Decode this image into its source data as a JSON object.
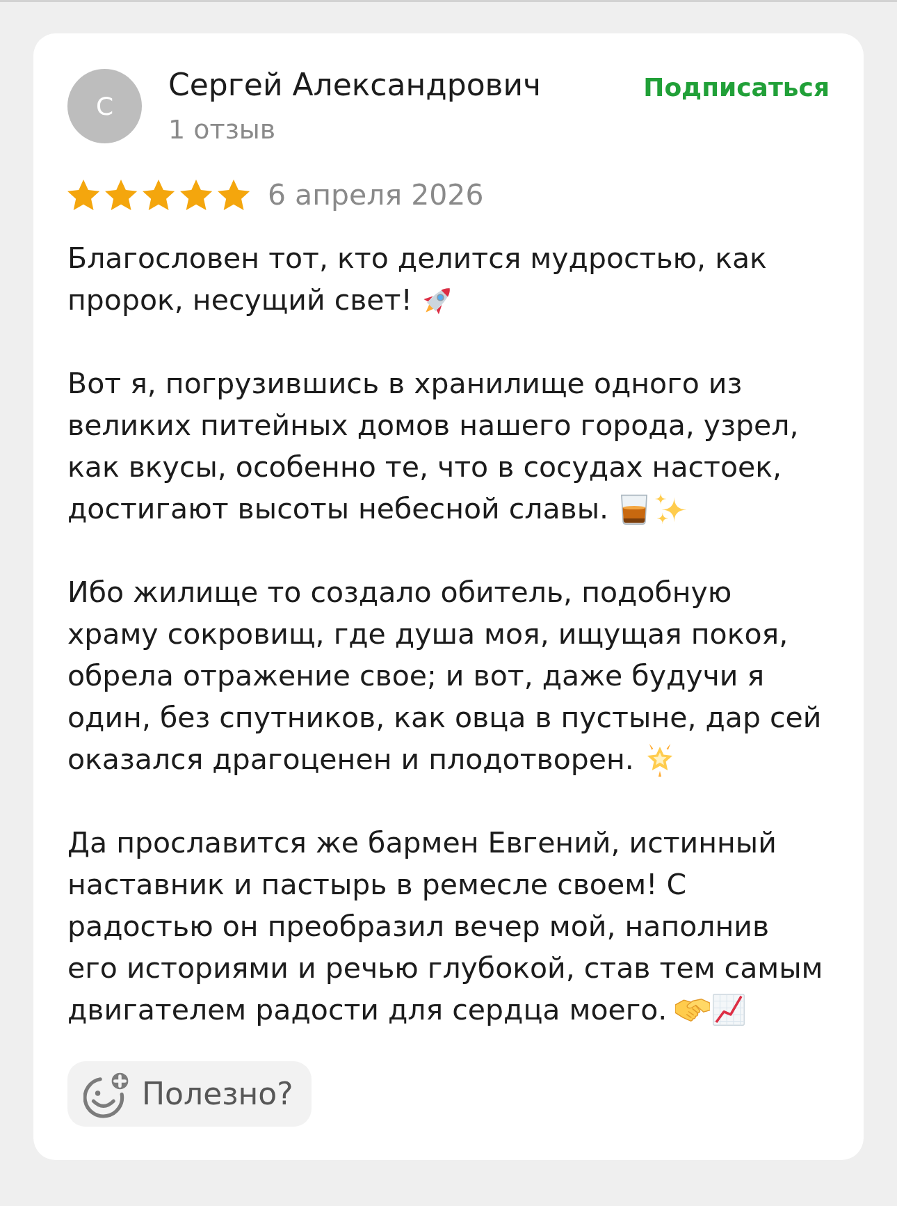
{
  "reviewer": {
    "avatar_letter": "С",
    "name": "Сергей Александрович",
    "review_count": "1 отзыв"
  },
  "subscribe_link": "Подписаться",
  "rating": {
    "stars": 5,
    "date": "6 апреля 2026"
  },
  "review": {
    "paragraphs": [
      {
        "lines": [
          "Благословен тот, кто делится мудростью, как",
          "пророк, несущий свет!"
        ],
        "emoji": [
          {
            "kind": "rocket"
          }
        ]
      },
      {
        "lines": [
          "Вот я, погрузившись в хранилище одного из",
          "великих питейных домов нашего города, узрел,",
          "как вкусы, особенно те, что в сосудах настоек,",
          "достигают высоты небесной славы."
        ],
        "emoji": [
          {
            "kind": "tumbler"
          },
          {
            "kind": "sparkles"
          }
        ]
      },
      {
        "lines": [
          "Ибо жилище то создало обитель, подобную",
          "храму сокровищ, где душа моя, ищущая покоя,",
          "обрела отражение свое; и вот, даже будучи я",
          "один, без спутников, как овца в пустыне, дар сей",
          "оказался драгоценен и плодотворен."
        ],
        "emoji": [
          {
            "kind": "glowingstar"
          }
        ]
      },
      {
        "lines": [
          "Да прославится же бармен Евгений, истинный",
          "наставник и пастырь в ремесле своем! С",
          "радостью он преобразил вечер мой, наполнив",
          "его историями и речью глубокой, став тем самым",
          "двигателем радости для сердца моего."
        ],
        "emoji": [
          {
            "kind": "handshake"
          },
          {
            "kind": "chart"
          }
        ]
      }
    ]
  },
  "helpful_button": {
    "label": "Полезно?"
  }
}
